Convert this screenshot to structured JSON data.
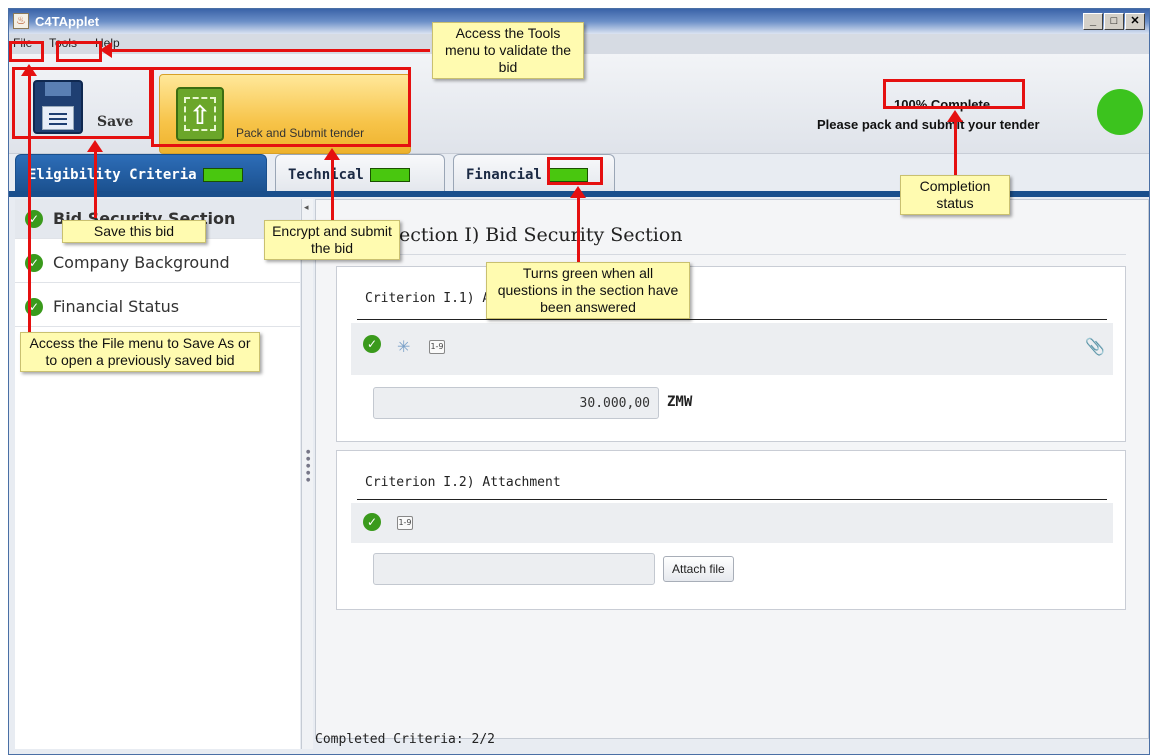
{
  "window": {
    "title": "C4TApplet",
    "app_icon": "java-icon",
    "min_label": "_",
    "max_label": "□",
    "close_label": "✕"
  },
  "menu": {
    "file": "File",
    "tools": "Tools",
    "help": "Help"
  },
  "toolbar": {
    "save_label": "Save",
    "pack_label": "Pack and Submit tender"
  },
  "status": {
    "title": "100% Complete",
    "message": "Please pack and submit your tender",
    "indicator_color": "#3cc31e"
  },
  "tabs": [
    {
      "label": "Eligibility Criteria",
      "progress": 1.0
    },
    {
      "label": "Technical",
      "progress": 1.0
    },
    {
      "label": "Financial",
      "progress": 1.0
    }
  ],
  "sidebar": {
    "items": [
      {
        "label": "Bid Security Section"
      },
      {
        "label": "Company Background"
      },
      {
        "label": "Financial Status"
      }
    ]
  },
  "content": {
    "section_title": "Section I) Bid Security Section",
    "criterion1": {
      "label": "Criterion I.1) Amount",
      "value": "30.000,00",
      "unit": "ZMW"
    },
    "criterion2": {
      "label": "Criterion I.2) Attachment",
      "attach_label": "Attach file"
    },
    "footer": "Completed Criteria: 2/2"
  },
  "callouts": {
    "tools": "Access the Tools menu to validate the bid",
    "completion": "Completion status",
    "save": "Save this bid",
    "encrypt": "Encrypt and submit the bid",
    "green": "Turns green when all questions in the section have been answered",
    "file": "Access the File menu to Save As or to open a previously saved bid"
  },
  "colors": {
    "accent": "#1a4f8c",
    "progress": "#49c70f",
    "annotation": "#e51010",
    "callout_bg": "#fffbb0"
  }
}
